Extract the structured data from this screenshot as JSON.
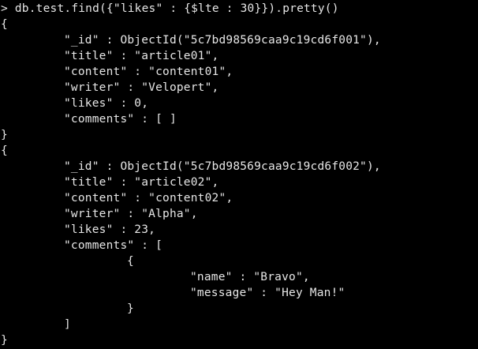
{
  "terminal": {
    "prompt": ">",
    "command": "db.test.find({\"likes\" : {$lte : 30}}).pretty()",
    "doc1": {
      "open": "{",
      "id": "\"_id\" : ObjectId(\"5c7bd98569caa9c19cd6f001\"),",
      "title": "\"title\" : \"article01\",",
      "content": "\"content\" : \"content01\",",
      "writer": "\"writer\" : \"Velopert\",",
      "likes": "\"likes\" : 0,",
      "comments": "\"comments\" : [ ]",
      "close": "}"
    },
    "doc2": {
      "open": "{",
      "id": "\"_id\" : ObjectId(\"5c7bd98569caa9c19cd6f002\"),",
      "title": "\"title\" : \"article02\",",
      "content": "\"content\" : \"content02\",",
      "writer": "\"writer\" : \"Alpha\",",
      "likes": "\"likes\" : 23,",
      "comments_open": "\"comments\" : [",
      "comment_open": "{",
      "comment_name": "\"name\" : \"Bravo\",",
      "comment_message": "\"message\" : \"Hey Man!\"",
      "comment_close": "}",
      "comments_close": "]",
      "close": "}"
    }
  },
  "colors": {
    "background": "#000000",
    "text": "#e6e6e6"
  }
}
